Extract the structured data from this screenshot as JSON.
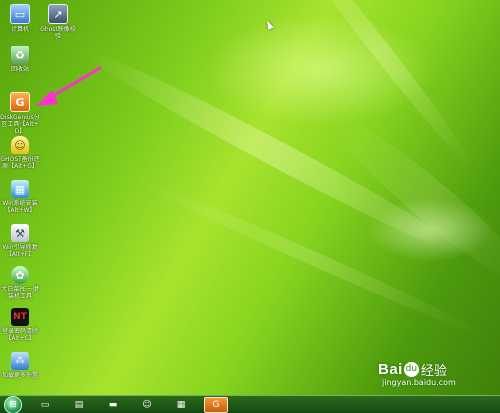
{
  "desktop_icons": [
    {
      "label": "计算机",
      "icon": "computer-icon"
    },
    {
      "label": "Ghost映像校验",
      "icon": "shortcut-icon"
    },
    {
      "label": "回收站",
      "icon": "recycle-bin-icon"
    },
    {
      "label": "DiskGenius分区工具【Alt+D】",
      "icon": "diskgenius-icon"
    },
    {
      "label": "GHOST备份还原【Alt+G】",
      "icon": "ghost-icon"
    },
    {
      "label": "Win系统安装【Alt+W】",
      "icon": "win-install-icon"
    },
    {
      "label": "Win引导修复【Alt+F】",
      "icon": "boot-repair-icon"
    },
    {
      "label": "大白菜PE一键装机工具",
      "icon": "pe-tool-icon"
    },
    {
      "label": "登录密码清除【Alt+C】",
      "icon": "nt-password-icon"
    },
    {
      "label": "加载更多外置",
      "icon": "load-more-icon"
    }
  ],
  "taskbar": {
    "start_icon": "windows-orb-icon",
    "items": [
      {
        "icon": "computer-icon"
      },
      {
        "icon": "partition-tool-icon"
      },
      {
        "icon": "usb-drive-icon"
      },
      {
        "icon": "ghost-icon"
      },
      {
        "icon": "win-install-icon"
      },
      {
        "icon": "diskgenius-icon",
        "active": true
      }
    ]
  },
  "watermark": {
    "brand": "Bai",
    "brand_tail": "du",
    "paw_glyph": "du",
    "jingyan": "经验",
    "url": "jingyan.baidu.com"
  },
  "annotation": {
    "arrow_color": "#ff2fd0",
    "target": "diskgenius-icon"
  },
  "colors": {
    "wallpaper_base": "#7ccd1c",
    "taskbar": "#124710",
    "active_taskbar_item": "#e07a1e"
  }
}
